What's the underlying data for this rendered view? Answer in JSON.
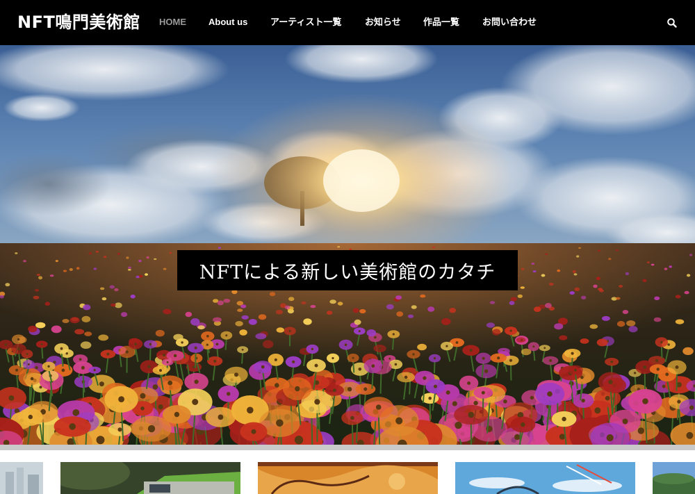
{
  "header": {
    "site_title": "NFT鳴門美術館",
    "nav": [
      {
        "label": "HOME",
        "active": true
      },
      {
        "label": "About us",
        "active": false
      },
      {
        "label": "アーティスト一覧",
        "active": false
      },
      {
        "label": "お知らせ",
        "active": false
      },
      {
        "label": "作品一覧",
        "active": false
      },
      {
        "label": "お問い合わせ",
        "active": false
      }
    ],
    "search_icon": "search-icon"
  },
  "hero": {
    "tagline": "NFTによる新しい美術館のカタチ"
  },
  "colors": {
    "header_bg": "#000000",
    "nav_active": "#9a9a9a",
    "nav_text": "#ffffff",
    "divider": "#c9c9c9"
  }
}
